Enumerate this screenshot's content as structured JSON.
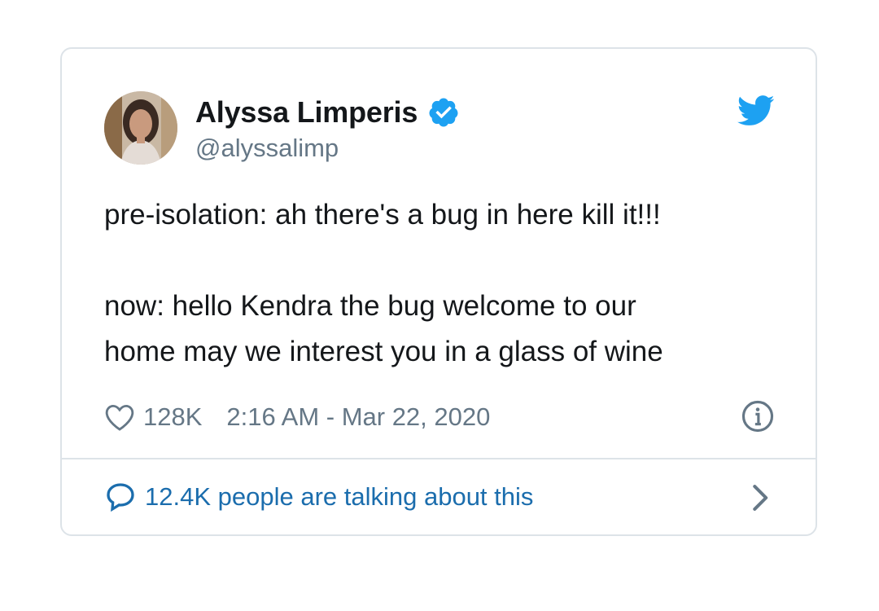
{
  "tweet": {
    "author": {
      "display_name": "Alyssa Limperis",
      "handle": "@alyssalimp",
      "verified": true,
      "avatar_icon": "profile-photo"
    },
    "text_lines": {
      "line1": "pre-isolation: ah there's a bug in here kill it!!!",
      "line2": "now: hello Kendra the bug welcome to our",
      "line3": "home may we interest you in a glass of wine"
    },
    "likes": "128K",
    "timestamp": "2:16 AM - Mar 22, 2020",
    "conversation": "12.4K people are talking about this"
  },
  "icons": {
    "brand": "twitter-bird-icon",
    "verified": "verified-badge-icon",
    "like": "heart-icon",
    "info": "info-icon",
    "reply": "speech-bubble-icon",
    "more": "chevron-right-icon"
  },
  "colors": {
    "twitter_blue": "#1da1f2",
    "text": "#14171a",
    "muted": "#657786",
    "link": "#1b6dad",
    "border": "#dde3e8"
  }
}
